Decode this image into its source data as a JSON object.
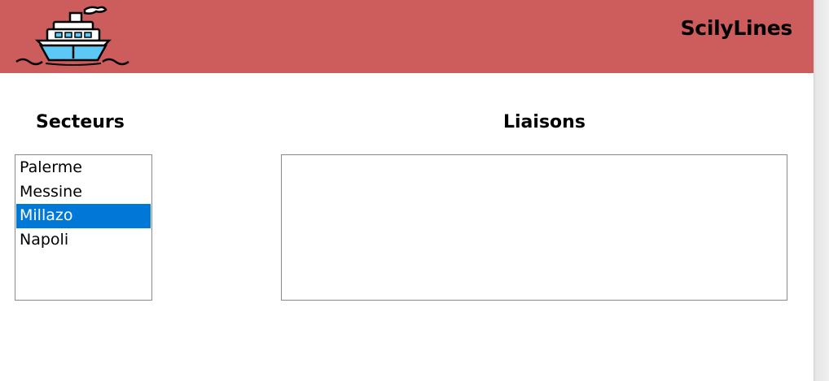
{
  "header": {
    "title": "ScilyLines",
    "logo_icon": "ship-icon",
    "background_color": "#cd5c5c"
  },
  "sectors": {
    "heading": "Secteurs",
    "items": [
      {
        "label": "Palerme",
        "selected": false
      },
      {
        "label": "Messine",
        "selected": false
      },
      {
        "label": "Millazo",
        "selected": true
      },
      {
        "label": "Napoli",
        "selected": false
      }
    ],
    "selection_color": "#0078d7"
  },
  "links": {
    "heading": "Liaisons",
    "items": []
  }
}
